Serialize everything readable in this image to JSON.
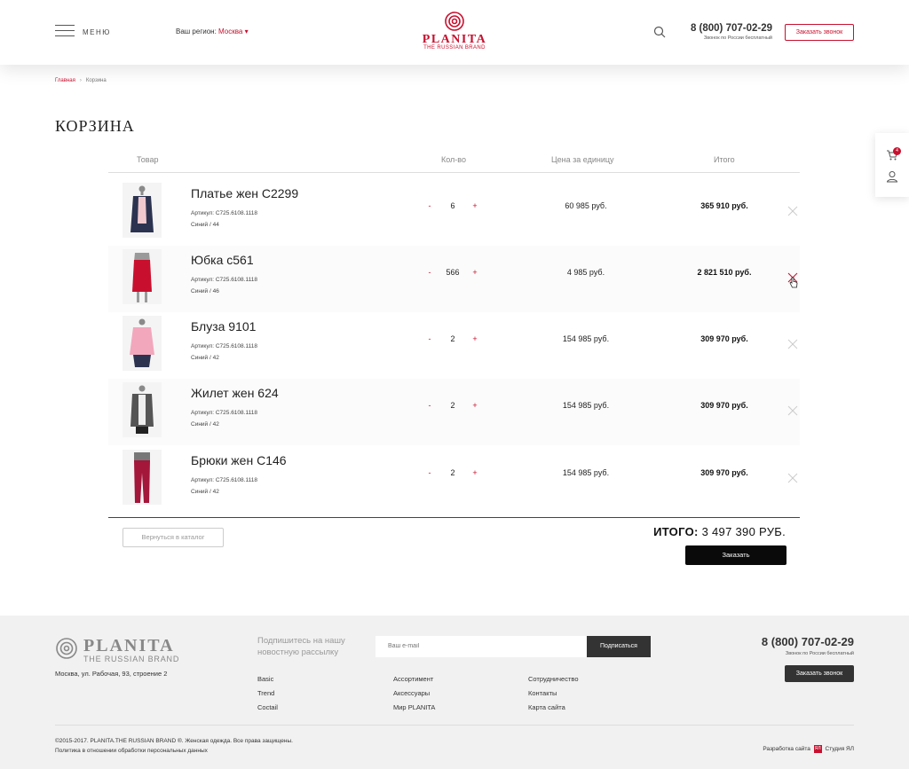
{
  "header": {
    "menu_label": "МЕНЮ",
    "region_label": "Ваш регион:",
    "region_city": "Москва",
    "region_arrow": "▾",
    "logo_brand": "PLANITA",
    "logo_sub": "THE RUSSIAN BRAND",
    "phone": "8 (800) 707-02-29",
    "phone_note": "Звонок по России бесплатный",
    "callback_label": "Заказать звонок"
  },
  "side_panel": {
    "cart_count": "4"
  },
  "breadcrumb": {
    "home": "Главная",
    "current": "Корзина"
  },
  "page_title": "КОРЗИНА",
  "table": {
    "headers": {
      "product": "Товар",
      "qty": "Кол-во",
      "unit_price": "Цена за единицу",
      "total": "Итого"
    },
    "rows": [
      {
        "name": "Платье жен С2299",
        "article": "Артикул: C725.6108.1118",
        "variant": "Синий / 44",
        "qty": "6",
        "unit_price": "60 985 руб.",
        "total": "365 910 руб.",
        "minus": "-",
        "plus": "+",
        "image": "dress-navy-jacket",
        "active": false
      },
      {
        "name": "Юбка с561",
        "article": "Артикул: C725.6108.1118",
        "variant": "Синий / 46",
        "qty": "566",
        "unit_price": "4 985 руб.",
        "total": "2 821 510 руб.",
        "minus": "-",
        "plus": "+",
        "image": "red-skirt",
        "active": true
      },
      {
        "name": "Блуза 9101",
        "article": "Артикул: C725.6108.1118",
        "variant": "Синий / 42",
        "qty": "2",
        "unit_price": "154 985 руб.",
        "total": "309 970 руб.",
        "minus": "-",
        "plus": "+",
        "image": "pink-blouse",
        "active": false
      },
      {
        "name": "Жилет жен 624",
        "article": "Артикул: C725.6108.1118",
        "variant": "Синий / 42",
        "qty": "2",
        "unit_price": "154 985 руб.",
        "total": "309 970 руб.",
        "minus": "-",
        "plus": "+",
        "image": "grey-vest",
        "active": false
      },
      {
        "name": "Брюки жен С146",
        "article": "Артикул: C725.6108.1118",
        "variant": "Синий / 42",
        "qty": "2",
        "unit_price": "154 985 руб.",
        "total": "309 970 руб.",
        "minus": "-",
        "plus": "+",
        "image": "red-trousers",
        "active": false
      }
    ]
  },
  "summary": {
    "back_label": "Вернуться в каталог",
    "total_label": "ИТОГО:",
    "total_value": "3 497 390 РУБ.",
    "order_label": "Заказать"
  },
  "footer": {
    "logo_brand": "PLANITA",
    "logo_sub": "THE RUSSIAN BRAND",
    "address": "Москва, ул. Рабочая, 93, строение 2",
    "subscribe_text": "Подпишитесь на нашу новостную рассылку",
    "email_placeholder": "Ваш e-mail",
    "subscribe_label": "Подписаться",
    "links_col1": [
      "Basic",
      "Trend",
      "Coctail"
    ],
    "links_col2": [
      "Ассортимент",
      "Аксессуары",
      "Мир PLANITA"
    ],
    "links_col3": [
      "Сотрудничество",
      "Контакты",
      "Карта сайта"
    ],
    "phone": "8 (800) 707-02-29",
    "phone_note": "Звонок по России бесплатный",
    "callback_label": "Заказать звонок",
    "copyright": "©2015-2017. PLANITA.THE RUSSIAN BRAND ®. Женская одежда. Все права защищены.",
    "policy": "Политика в отношении обработки персональных данных",
    "dev_label": "Разработка сайта",
    "dev_mark": "ЯЛ",
    "dev_name": "Студия ЯЛ"
  },
  "colors": {
    "accent": "#c8102e",
    "dark": "#0a0a0a",
    "footer_bg": "#f1f1f1"
  }
}
